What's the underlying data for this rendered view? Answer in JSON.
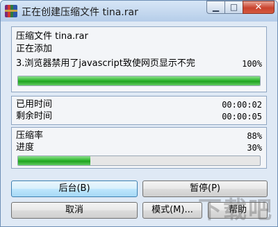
{
  "window": {
    "title": "正在创建压缩文件 tina.rar"
  },
  "controls": {
    "minimize": "▁",
    "maximize": "□",
    "close": "✕"
  },
  "status": {
    "archive_line": "压缩文件 tina.rar",
    "action_line": "正在添加",
    "file_line": "3.浏览器禁用了javascript致使网页显示不完",
    "file_percent": "100%",
    "file_progress": 1.0
  },
  "timing": {
    "elapsed_label": "已用时间",
    "elapsed_value": "00:00:02",
    "remaining_label": "剩余时间",
    "remaining_value": "00:00:05"
  },
  "stats": {
    "ratio_label": "压缩率",
    "ratio_value": "88%",
    "progress_label": "进度",
    "progress_value": "30%",
    "total_progress": 0.3
  },
  "buttons": {
    "background": "后台(B)",
    "pause": "暂停(P)",
    "cancel": "取消",
    "mode": "模式(M)...",
    "help": "帮助"
  },
  "watermark": "下载吧"
}
